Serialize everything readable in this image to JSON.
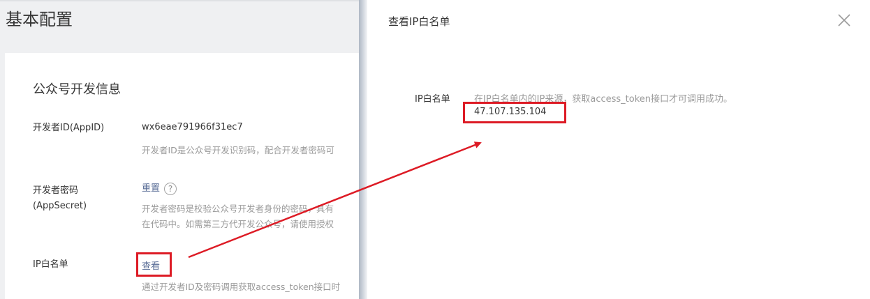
{
  "page": {
    "title": "基本配置"
  },
  "dev_info": {
    "section_title": "公众号开发信息",
    "appid": {
      "label": "开发者ID(AppID)",
      "value": "wx6eae791966f31ec7",
      "desc": "开发者ID是公众号开发识别码，配合开发者密码可"
    },
    "secret": {
      "label_line1": "开发者密码",
      "label_line2": "(AppSecret)",
      "reset_label": "重置",
      "help_glyph": "?",
      "desc_line1": "开发者密码是校验公众号开发者身份的密码，具有",
      "desc_line2": "在代码中。如需第三方代开发公众号，请使用授权"
    },
    "whitelist": {
      "label": "IP白名单",
      "view_label": "查看",
      "desc": "通过开发者ID及密码调用获取access_token接口时"
    }
  },
  "dialog": {
    "title": "查看IP白名单",
    "close_icon": "close-icon",
    "field_label": "IP白名单",
    "hint": "在IP白名单内的IP来源，获取access_token接口才可调用成功。",
    "ips": [
      "47.107.135.104"
    ]
  },
  "colors": {
    "highlight": "#dd1b25",
    "link": "#576b95",
    "muted": "#9a9a9a"
  }
}
